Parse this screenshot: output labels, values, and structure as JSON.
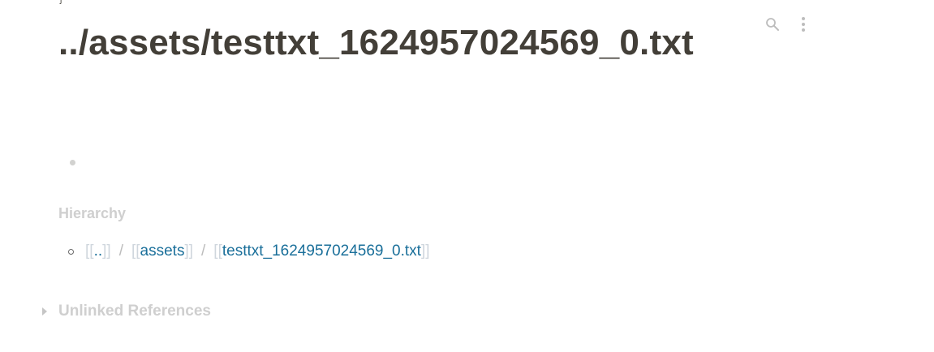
{
  "page": {
    "title": "../assets/testtxt_1624957024569_0.txt"
  },
  "toolbar": {
    "search_icon": "search-icon",
    "more_icon": "more-vertical-icon"
  },
  "hierarchy": {
    "heading": "Hierarchy",
    "open_bracket": "[[",
    "close_bracket": "]]",
    "separator": "/",
    "parts": [
      "..",
      "assets",
      "testtxt_1624957024569_0.txt"
    ]
  },
  "references": {
    "unlinked_label": "Unlinked References"
  },
  "colors": {
    "text": "#433f38",
    "link": "#1a6f9a",
    "muted": "#cfcfcf"
  }
}
